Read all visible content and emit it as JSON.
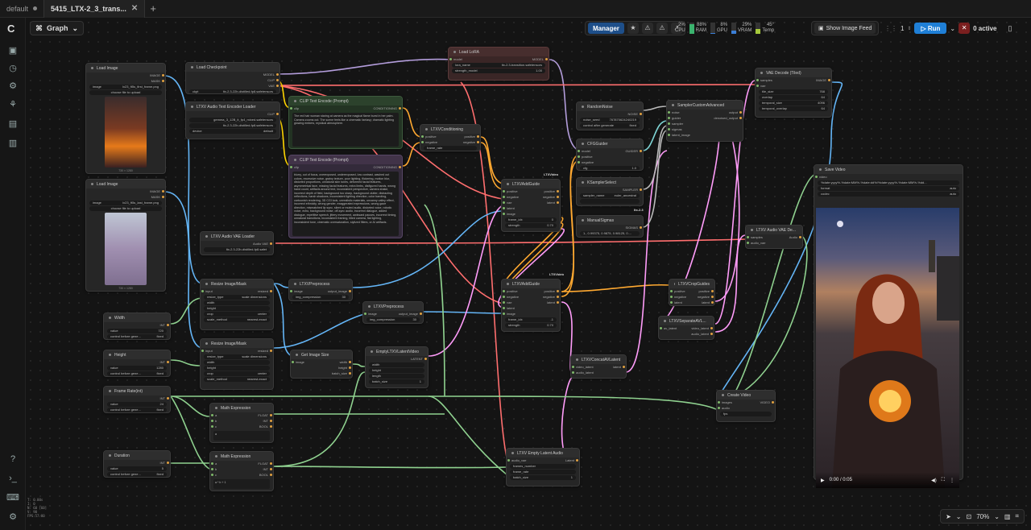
{
  "tabs": [
    {
      "label": "default",
      "active": false
    },
    {
      "label": "5415_LTX-2_3_trans...",
      "active": true
    }
  ],
  "graph_label": "Graph",
  "topbar": {
    "manager": "Manager",
    "cpu": {
      "label": "CPU",
      "value": "2%"
    },
    "ram": {
      "label": "RAM",
      "value": "88%"
    },
    "gpu": {
      "label": "GPU",
      "value": "8%"
    },
    "vram": {
      "label": "VRAM",
      "value": "29%"
    },
    "temp": {
      "label": "Temp",
      "value": "45°"
    },
    "image_feed": "Show Image Feed",
    "queue_count": "1",
    "run": "Run",
    "active": "0 active"
  },
  "nodes": {
    "load_image_1": {
      "title": "Load Image",
      "out1": "IMAGE",
      "out2": "MASK",
      "image": "lx23_ft5s_first_frame.png",
      "upload": "choose file to upload",
      "caption": "730 × 1280"
    },
    "load_image_2": {
      "title": "Load Image",
      "out1": "IMAGE",
      "out2": "MASK",
      "image": "lx23_ft5s_last_frame.png",
      "upload": "choose file to upload",
      "caption": "730 × 1280"
    },
    "load_checkpoint": {
      "title": "Load Checkpoint",
      "o1": "MODEL",
      "o2": "CLIP",
      "o3": "VAE",
      "ckpt": "ltx-2.3-22b-distilled-fp8.safetensors"
    },
    "audio_text_encoder": {
      "title": "LTXV Audio Text Encoder Loader",
      "o1": "CLIP",
      "w1": "gemma_3_12B_it_fp4_mixed.safetensors",
      "w2": "ltx-2.3-22b-distilled-fp8.safetensors",
      "w3": "default"
    },
    "clip_pos": {
      "title": "CLIP Text Encode (Prompt)",
      "in": "clip",
      "out": "CONDITIONING",
      "text": "The red hair woman staring at camera as the magical flame burst in her palm. Camera zooms out. The scene feels like a cinematic fantasy; dramatic lighting glowing embers, mystical atmosphere."
    },
    "clip_neg": {
      "title": "CLIP Text Encode (Prompt)",
      "in": "clip",
      "out": "CONDITIONING",
      "text": "blurry, out of focus, overexposed, underexposed, low contrast, washed out colors, excessive noise, grainy texture, poor lighting, flickering, motion blur, distorted proportions, unnatural skin tones, deformed facial features, asymmetrical face, missing facial features, extra limbs, disfigured hands, wrong hand count, artifacts around text, inconsistent perspective, camera shake, incorrect depth of field, background too sharp, background clutter, distracting reflections, harsh shadows, inconsistent lighting direction, color banding, cartoonish rendering, 3D CGI look, unrealistic materials, uncanny valley effect, incorrect ethnicity, wrong gender, exaggerated expressions, wrong gaze direction, mismatched lip sync, silent or muted audio, distorted voice, robotic voice, echo, background noise, off-sync audio, incorrect dialogue, added dialogue, repetitive speech, jittery movement, awkward pauses, incorrect timing, unnatural transitions, inconsistent framing, tilted camera, flat lighting, inconsistent tone, cinematic oversaturation, stylized filters, or AI artifacts."
    },
    "conditioning": {
      "title": "LTXVConditioning",
      "i1": "positive",
      "i2": "negative",
      "o1": "positive",
      "o2": "negative",
      "w": "frame_rate"
    },
    "audio_vae": {
      "title": "LTXV Audio VAE Loader",
      "o": "Audio VAE",
      "w": "ltx-2.3-22b-distilled-fp8.safet"
    },
    "load_lora": {
      "title": "Load LoRA",
      "i": "model",
      "o": "MODEL",
      "w1": "ltx-2.3-transition.safetensors",
      "w2": "strength_model",
      "v2": "1.00"
    },
    "addguide_1": {
      "title": "LTXVAddGuide",
      "badge": "LTXVideo",
      "i1": "positive",
      "i2": "negative",
      "i3": "vae",
      "i4": "latent",
      "i5": "image",
      "o1": "positive",
      "o2": "negative",
      "o3": "latent",
      "w1": "frame_idx",
      "v1": "0",
      "w2": "strength",
      "v2": "0.70"
    },
    "addguide_2": {
      "title": "LTXVAddGuide",
      "badge": "LTXVideo",
      "i1": "positive",
      "i2": "negative",
      "i3": "vae",
      "i4": "latent",
      "i5": "image",
      "o1": "positive",
      "o2": "negative",
      "o3": "latent",
      "w1": "frame_idx",
      "v1": "-1",
      "w2": "strength",
      "v2": "0.70"
    },
    "random_noise": {
      "title": "RandomNoise",
      "o": "NOISE",
      "w1": "noise_seed",
      "v1": "767870624240219",
      "w2": "control after generate",
      "v2": "fixed"
    },
    "cfg_guider": {
      "title": "CFGGuider",
      "i1": "model",
      "i2": "positive",
      "i3": "negative",
      "o": "GUIDER",
      "w": "cfg",
      "v": "1.0"
    },
    "sampler_select": {
      "title": "KSamplerSelect",
      "o": "SAMPLER",
      "w1": "sampler_name",
      "v1": "euler_ancestral"
    },
    "manual_sigmas": {
      "title": "ManualSigmas",
      "o": "SIGMAS",
      "v": "1., 0.99375, 0.9875, 0.98125, 0...."
    },
    "sampler_advanced": {
      "title": "SamplerCustomAdvanced",
      "i1": "noise",
      "i2": "guider",
      "i3": "sampler",
      "i4": "sigmas",
      "i5": "latent_image",
      "o1": "output",
      "o2": "denoised_output"
    },
    "vae_decode": {
      "title": "VAE Decode (Tiled)",
      "i1": "samples",
      "i2": "vae",
      "o": "IMAGE",
      "w1": "tile_size",
      "v1": "768",
      "w2": "overlap",
      "v2": "64",
      "w3": "temporal_size",
      "v3": "4096",
      "w4": "temporal_overlap",
      "v4": "64"
    },
    "save_video": {
      "title": "Save Video",
      "i": "video",
      "w1": "filename_prefix",
      "v1": "%date:yyyy%-%date:MM%-%date:dd%/%date:yyyy%-%date:MM%-%dd...",
      "w2": "format",
      "v2": "auto",
      "w3": "codec",
      "v3": "auto",
      "time": "0:00 / 0:05"
    },
    "audio_vae_decode": {
      "title": "LTXV Audio VAE De...",
      "i1": "samples",
      "i2": "audio_vae",
      "o": "Audio"
    },
    "resize_1": {
      "title": "Resize Image/Mask",
      "i1": "input",
      "i2": "resize_type",
      "v2": "scale dimensions",
      "o": "resized",
      "w1": "width",
      "w2": "height",
      "w3": "crop",
      "v3": "center",
      "w4": "scale_method",
      "v4": "nearest-exact"
    },
    "resize_2": {
      "title": "Resize Image/Mask",
      "i1": "input",
      "i2": "resize_type",
      "v2": "scale dimensions",
      "o": "resized",
      "w1": "width",
      "w2": "height",
      "w3": "crop",
      "v3": "center",
      "w4": "scale_method",
      "v4": "nearest-exact"
    },
    "preprocess_1": {
      "title": "LTXVPreprocess",
      "i": "image",
      "o": "output_image",
      "w": "img_compression",
      "v": "30"
    },
    "preprocess_2": {
      "title": "LTXVPreprocess",
      "i": "image",
      "o": "output_image",
      "w": "img_compression",
      "v": "30"
    },
    "width": {
      "title": "Width",
      "o": "INT",
      "w1": "value",
      "v1": "720",
      "w2": "control before gene...",
      "v2": "fixed"
    },
    "height": {
      "title": "Height",
      "o": "INT",
      "w1": "value",
      "v1": "1280",
      "w2": "control before gene...",
      "v2": "fixed"
    },
    "frame_rate": {
      "title": "Frame Rate(int)",
      "o": "INT",
      "w1": "value",
      "v1": "24",
      "w2": "control before gene...",
      "v2": "fixed"
    },
    "duration": {
      "title": "Duration",
      "o": "INT",
      "w1": "value",
      "v1": "5",
      "w2": "control before gene...",
      "v2": "fixed"
    },
    "get_image_size": {
      "title": "Get Image Size",
      "i": "image",
      "o1": "width",
      "o2": "height",
      "o3": "batch_size"
    },
    "empty_latent": {
      "title": "EmptyLTXVLatentVideo",
      "o": "LATENT",
      "w1": "width",
      "w2": "height",
      "w3": "length",
      "w4": "batch_size",
      "v4": "1"
    },
    "math_1": {
      "title": "Math Expression",
      "i1": "a",
      "i2": "b",
      "i3": "c",
      "o1": "FLOAT",
      "o2": "INT",
      "o3": "BOOL",
      "expr": "a"
    },
    "math_2": {
      "title": "Math Expression",
      "i1": "a",
      "i2": "b",
      "i3": "c",
      "o1": "FLOAT",
      "o2": "INT",
      "o3": "BOOL",
      "expr": "a * b + 1"
    },
    "concat_latent": {
      "title": "LTXVConcatAVLatent",
      "i1": "video_latent",
      "i2": "audio_latent",
      "o": "latent"
    },
    "crop_guides": {
      "title": "LTXVCropGuides",
      "i1": "positive",
      "i2": "negative",
      "i3": "latent",
      "o1": "positive",
      "o2": "negative",
      "o3": "latent"
    },
    "separate_latent": {
      "title": "LTXVSeparateAVL...",
      "i": "av_latent",
      "o1": "video_latent",
      "o2": "audio_latent"
    },
    "empty_audio": {
      "title": "LTXV Empty Latent Audio",
      "i": "audio_vae",
      "o": "Latent",
      "w1": "frames_number",
      "w2": "frame_rate",
      "w3": "batch_size",
      "v3": "1"
    },
    "create_video": {
      "title": "Create Video",
      "i1": "images",
      "i2": "audio",
      "o": "VIDEO",
      "w": "fps"
    }
  },
  "sampler_badge": "ltx-2.3",
  "zoom": "70%",
  "stats": [
    "T: 0.00s",
    "I: 0",
    "N: 60 [60]",
    "V: 90",
    "FPS:57.80"
  ],
  "colors": {
    "accent": "#1f7fd6",
    "wire_image": "#64b5f6",
    "wire_model": "#b39ddb",
    "wire_cond": "#ffa931",
    "wire_latent": "#ff9cf9",
    "wire_vae": "#ff6e6e",
    "wire_int": "#7fb86a"
  }
}
